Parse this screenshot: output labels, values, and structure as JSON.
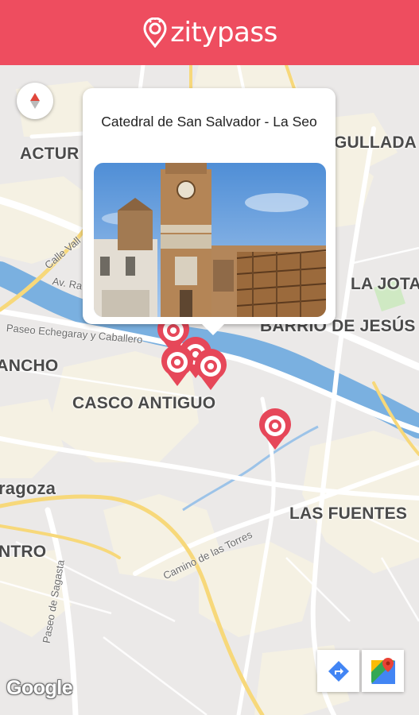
{
  "header": {
    "logo_text": "zitypass"
  },
  "popup": {
    "title": "Catedral de San Salvador - La Seo"
  },
  "map": {
    "districts": [
      "ACTUR",
      "GULLADA",
      "LA JOTA",
      "BARRIO DE JESÚS",
      "RANCHO",
      "CASCO ANTIGUO",
      "ragoza",
      "LAS FUENTES",
      "NTRO"
    ],
    "streets": [
      "Calle Vall",
      "Av. Ra",
      "Paseo Echegaray y Caballero",
      "Camino de las Torres",
      "Paseo de Sagasta"
    ],
    "attribution": "Google"
  },
  "icons": {
    "compass": "compass-icon",
    "pin": "map-pin-icon",
    "directions": "directions-icon",
    "maps": "google-maps-icon"
  },
  "colors": {
    "brand": "#ee4d5f",
    "river": "#7ab0e0",
    "pin": "#e64759"
  }
}
